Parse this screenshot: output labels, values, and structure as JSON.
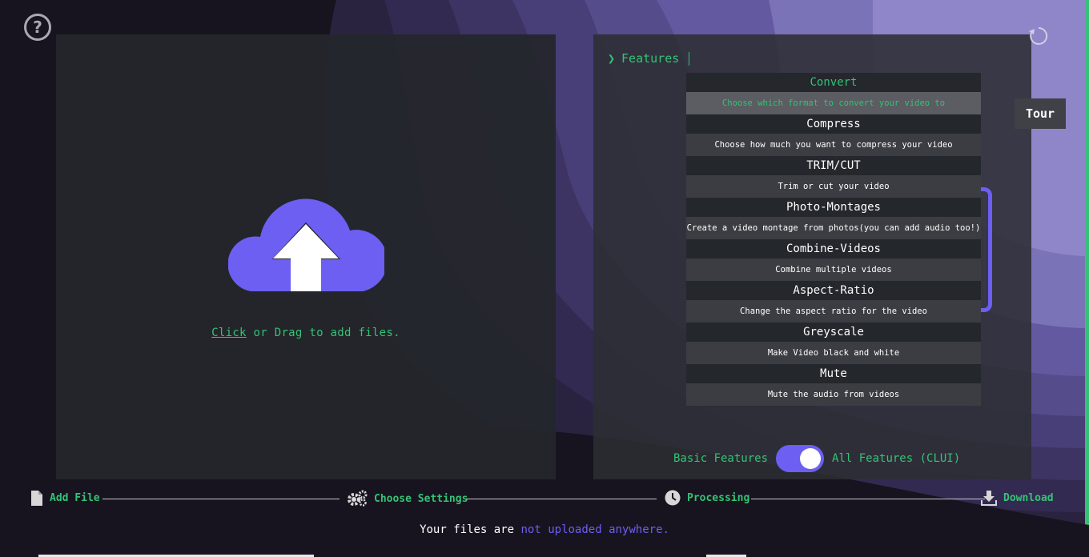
{
  "help": {
    "icon": "help-icon",
    "glyph": "?"
  },
  "reset": {
    "icon": "reset-icon"
  },
  "upload": {
    "icon": "cloud-upload-icon",
    "click_label": "Click",
    "rest_label": " or Drag to add files."
  },
  "features": {
    "title": "Features",
    "chevron": "❯",
    "items": [
      {
        "name": "Convert",
        "description": "Choose which format to convert your video to"
      },
      {
        "name": "Compress",
        "description": "Choose how much you want to compress your video"
      },
      {
        "name": "TRIM/CUT",
        "description": "Trim or cut your video"
      },
      {
        "name": "Photo-Montages",
        "description": "Create a video montage from photos(you can add audio too!)"
      },
      {
        "name": "Combine-Videos",
        "description": "Combine multiple videos"
      },
      {
        "name": "Aspect-Ratio",
        "description": "Change the aspect ratio for the video"
      },
      {
        "name": "Greyscale",
        "description": "Make Video black and white"
      },
      {
        "name": "Mute",
        "description": "Mute the audio from videos"
      }
    ],
    "mode_left": "Basic Features",
    "mode_right": "All Features (CLUI)"
  },
  "tour": {
    "label": "Tour"
  },
  "steps": [
    {
      "label": "Add File",
      "icon": "file-icon"
    },
    {
      "label": "Choose Settings",
      "icon": "gears-icon"
    },
    {
      "label": "Processing",
      "icon": "clock-icon"
    },
    {
      "label": "Download",
      "icon": "download-icon"
    }
  ],
  "footer": {
    "prefix": "Your files are ",
    "accent": "not uploaded anywhere."
  },
  "colors": {
    "accent": "#6c5ff2",
    "green": "#34c374",
    "background": "#17141f"
  }
}
